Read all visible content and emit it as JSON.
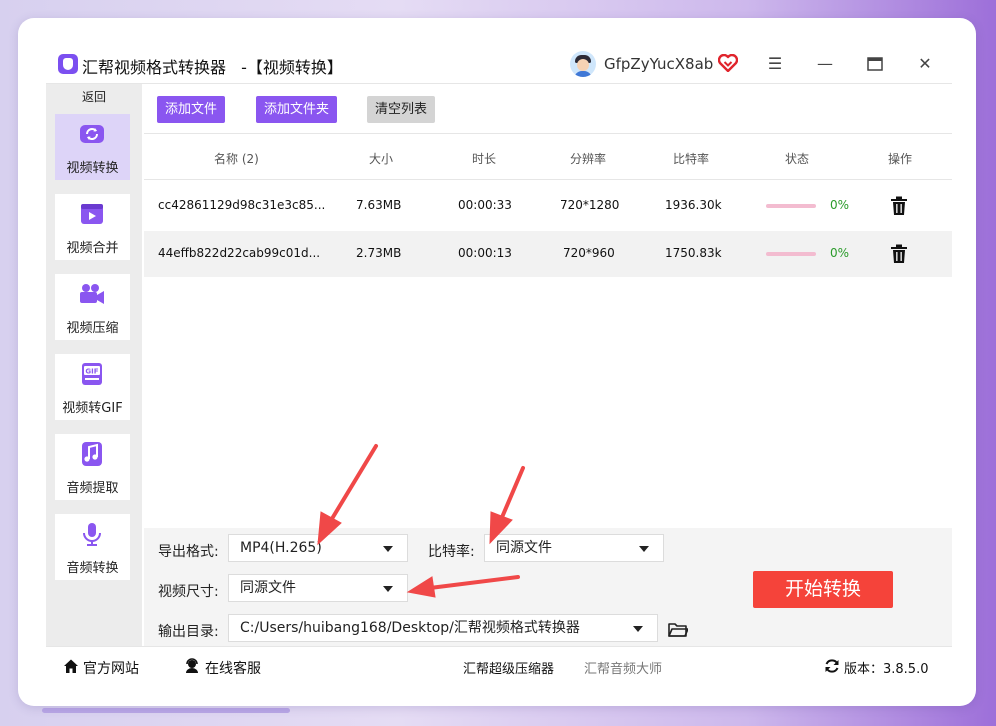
{
  "window": {
    "app_name": "汇帮视频格式转换器",
    "title_suffix": "-【视频转换】",
    "username": "GfpZyYucX8ab"
  },
  "sidebar": {
    "back_label": "返回",
    "items": [
      {
        "label": "视频转换",
        "icon": "video-convert-icon",
        "active": true
      },
      {
        "label": "视频合并",
        "icon": "video-merge-icon",
        "active": false
      },
      {
        "label": "视频压缩",
        "icon": "video-compress-icon",
        "active": false
      },
      {
        "label": "视频转GIF",
        "icon": "gif-icon",
        "active": false
      },
      {
        "label": "音频提取",
        "icon": "music-note-icon",
        "active": false
      },
      {
        "label": "音频转换",
        "icon": "microphone-icon",
        "active": false
      }
    ]
  },
  "toolbar": {
    "add_file": "添加文件",
    "add_folder": "添加文件夹",
    "clear_list": "清空列表"
  },
  "table": {
    "headers": {
      "name": "名称 (2)",
      "size": "大小",
      "duration": "时长",
      "resolution": "分辨率",
      "bitrate": "比特率",
      "status": "状态",
      "action": "操作"
    },
    "rows": [
      {
        "name": "cc42861129d98c31e3c85...",
        "size": "7.63MB",
        "duration": "00:00:33",
        "resolution": "720*1280",
        "bitrate": "1936.30k",
        "progress": "0%"
      },
      {
        "name": "44effb822d22cab99c01d...",
        "size": "2.73MB",
        "duration": "00:00:13",
        "resolution": "720*960",
        "bitrate": "1750.83k",
        "progress": "0%"
      }
    ]
  },
  "settings": {
    "format_label": "导出格式:",
    "format_value": "MP4(H.265)",
    "bitrate_label": "比特率:",
    "bitrate_value": "同源文件",
    "size_label": "视频尺寸:",
    "size_value": "同源文件",
    "output_label": "输出目录:",
    "output_value": "C:/Users/huibang168/Desktop/汇帮视频格式转换器",
    "start_button": "开始转换"
  },
  "footer": {
    "website": "官方网站",
    "support": "在线客服",
    "link_compressor": "汇帮超级压缩器",
    "link_audio": "汇帮音频大师",
    "version": "版本：3.8.5.0"
  },
  "colors": {
    "accent_purple": "#8a56f0",
    "start_red": "#f5433a",
    "progress_green": "#2a9b2a",
    "arrow_red": "#f04848"
  }
}
